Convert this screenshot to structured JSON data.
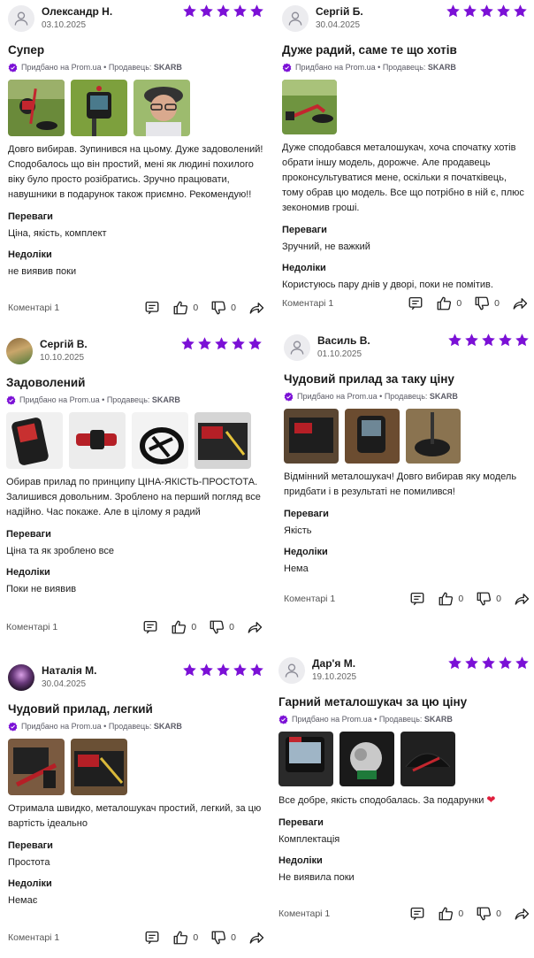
{
  "colors": {
    "star": "#7b10d6",
    "bought_icon": "#7b10d6",
    "text": "#1a1a1a"
  },
  "bought_text": "Придбано на Prom.ua • Продавець:",
  "seller": "SKARB",
  "labels": {
    "pros": "Переваги",
    "cons": "Недоліки",
    "comments": "Коментарі 1",
    "likes": "0",
    "dislikes": "0"
  },
  "reviews": [
    {
      "name": "Олександр Н.",
      "date": "03.10.2025",
      "rating": 5,
      "title": "Супер",
      "text": "Довго вибирав. Зупинився на цьому. Дуже задоволений! Сподобалось що він простий, мені як людині похилого віку було просто розібратись. Зручно працювати, навушники в подарунок також приємно. Рекомендую!!",
      "pros": "Ціна, якість, комплект",
      "cons": "не виявив поки"
    },
    {
      "name": "Сергій Б.",
      "date": "30.04.2025",
      "rating": 5,
      "title": "Дуже радий, саме те що хотів",
      "text": "Дуже сподобався металошукач, хоча спочатку хотів обрати іншу модель, дорожче. Але продавець проконсультуватися мене, оскільки я початківець, тому обрав цю модель. Все що потрібно в ній є, плюс зекономив гроші.",
      "pros": "Зручний, не важкий",
      "cons": "Користуюсь пару днів у дворі, поки не помітив."
    },
    {
      "name": "Сергій В.",
      "date": "10.10.2025",
      "rating": 5,
      "title": "Задоволений",
      "text": "Обирав прилад по принципу ЦІНА-ЯКІСТЬ-ПРОСТОТА. Залишився довольним. Зроблено на перший погляд все надійно. Час покаже. Але в цілому я радий",
      "pros": "Ціна та як зроблено все",
      "cons": "Поки не виявив"
    },
    {
      "name": "Василь В.",
      "date": "01.10.2025",
      "rating": 5,
      "title": "Чудовий прилад за таку ціну",
      "text": "Відмінний металошукач! Довго вибирав яку модель придбати і в результаті не помилився!",
      "pros": "Якість",
      "cons": "Нема"
    },
    {
      "name": "Наталія М.",
      "date": "30.04.2025",
      "rating": 5,
      "title": "Чудовий прилад, легкий",
      "text": "Отримала швидко, металошукач простий, легкий, за цю вартість ідеально",
      "pros": "Простота",
      "cons": "Немає"
    },
    {
      "name": "Дар'я М.",
      "date": "19.10.2025",
      "rating": 5,
      "title": "Гарний металошукач за цю ціну",
      "text": "Все добре, якість сподобалась. За подарунки",
      "pros": "Комплектація",
      "cons": "Не виявила поки"
    }
  ]
}
